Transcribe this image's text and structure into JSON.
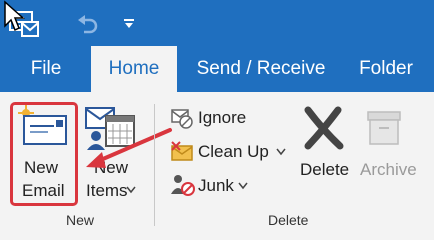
{
  "tabs": [
    {
      "label": "File"
    },
    {
      "label": "Home"
    },
    {
      "label": "Send / Receive"
    },
    {
      "label": "Folder"
    }
  ],
  "ribbon": {
    "new_group": {
      "new_email": {
        "line1": "New",
        "line2": "Email"
      },
      "new_items": {
        "line1": "New",
        "line2": "Items"
      },
      "group_label": "New"
    },
    "delete_group": {
      "ignore": "Ignore",
      "clean_up": "Clean Up",
      "junk": "Junk",
      "delete": "Delete",
      "archive": "Archive",
      "group_label": "Delete"
    }
  },
  "colors": {
    "title_bar": "#1f6fbf",
    "highlight": "#d9363e",
    "ribbon_bg": "#f3f3f3"
  },
  "icons": [
    "app-icon",
    "undo-icon",
    "qat-dropdown-icon",
    "mouse-cursor-icon",
    "new-email-icon",
    "new-items-icon",
    "ignore-icon",
    "clean-up-icon",
    "junk-icon",
    "delete-icon",
    "archive-icon",
    "arrow-annotation"
  ]
}
